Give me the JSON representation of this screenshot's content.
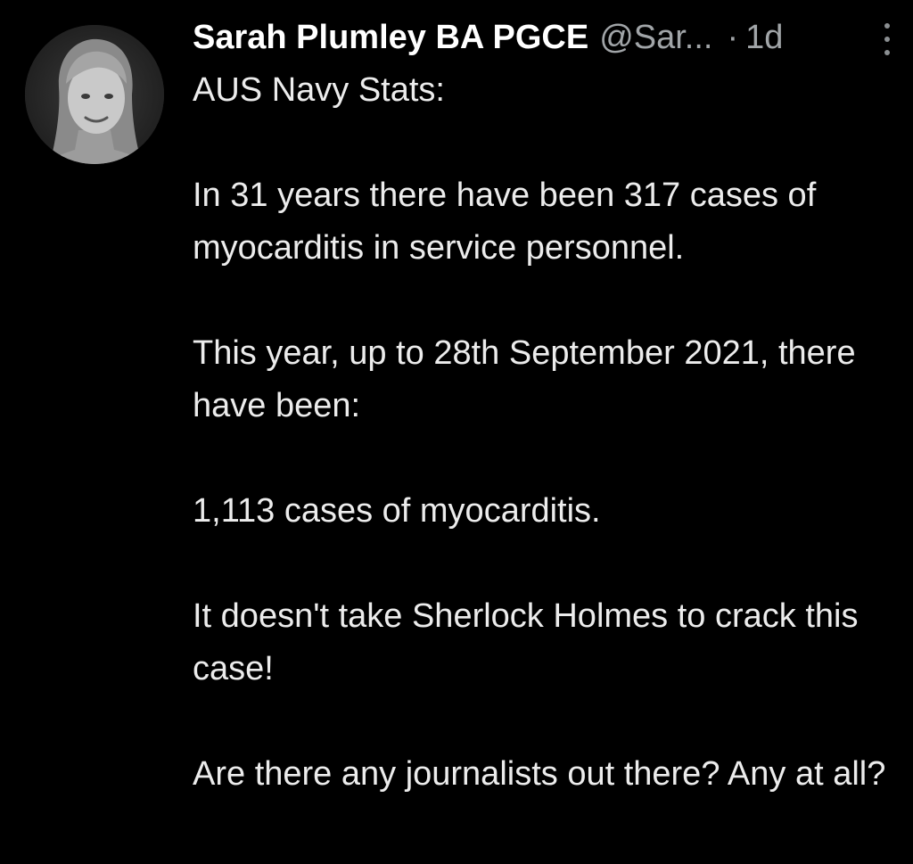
{
  "tweet": {
    "author": {
      "display_name": "Sarah Plumley BA PGCE",
      "handle": "@Sar...",
      "avatar_icon": "profile-photo"
    },
    "separator": "·",
    "timestamp": "1d",
    "more_icon": "vertical-ellipsis-icon",
    "paragraphs": [
      "AUS Navy Stats:",
      "In 31 years there have been 317 cases of myocarditis in service personnel.",
      "This year, up to 28th September 2021, there have been:",
      "1,113 cases of myocarditis.",
      "It doesn't take Sherlock Holmes to crack this case!",
      "Are there any journalists out there? Any at all?"
    ]
  },
  "colors": {
    "background": "#000000",
    "primary_text": "#ececec",
    "secondary_text": "#a1a5a8"
  }
}
